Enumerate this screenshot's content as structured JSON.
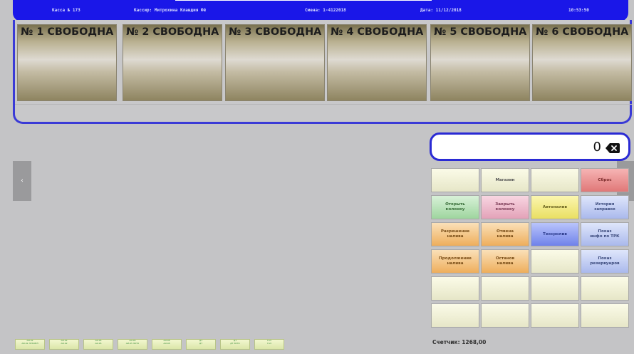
{
  "header": {
    "register": "Касса № 173",
    "cashier": "Кассир: Митрохина Клавдия Фё",
    "shift": "Смена: 1-4122018",
    "date": "Дата: 11/12/2018",
    "time": "10:53:50"
  },
  "pumps": [
    {
      "title": "№ 1  СВОБОДНА"
    },
    {
      "title": "№ 2  СВОБОДНА"
    },
    {
      "title": "№ 3  СВОБОДНА"
    },
    {
      "title": "№ 4  СВОБОДНА"
    },
    {
      "title": "№ 5  СВОБОДНА"
    },
    {
      "title": "№ 6  СВОБОДНА"
    }
  ],
  "display": {
    "value": "0"
  },
  "keys": {
    "k01": "",
    "k02": "Магазин",
    "k03": "",
    "k04": "Сброс",
    "k05": "Открыть\nколонку",
    "k06": "Закрыть\nколонку",
    "k07": "Автоналив",
    "k08": "История\nзаправок",
    "k09": "Разрешение\nналива",
    "k10": "Отмена\nналива",
    "k11": "Техсролив",
    "k12": "Показ\nинфо по ТРК",
    "k13": "Продолжение\nналива",
    "k14": "Останов\nналива",
    "k15": "",
    "k16": "Показ\nрезервуаров",
    "k17": "",
    "k18": "",
    "k19": "",
    "k20": "",
    "k21": "",
    "k22": "",
    "k23": "",
    "k24": ""
  },
  "bottom_buttons": [
    {
      "label": "АИ-92\nАИ-92 ЛУКОЙЛ"
    },
    {
      "label": "АИ-92\nАИ-92"
    },
    {
      "label": "АИ-95\nАИ-95"
    },
    {
      "label": "АИ-95\nАИ-95 ЭКТО"
    },
    {
      "label": "АИ-98\nАИ-98"
    },
    {
      "label": "ДТ\nДТ"
    },
    {
      "label": "ДТ\nДТ ЭКТО"
    },
    {
      "label": "ГАЗ\nГАЗ"
    }
  ],
  "counter": {
    "text": "Счетчик: 1268,00"
  },
  "colors": {
    "header_bar": "#1a17e8",
    "panel_border": "#3a3ad6",
    "background": "#c4c4c6"
  }
}
